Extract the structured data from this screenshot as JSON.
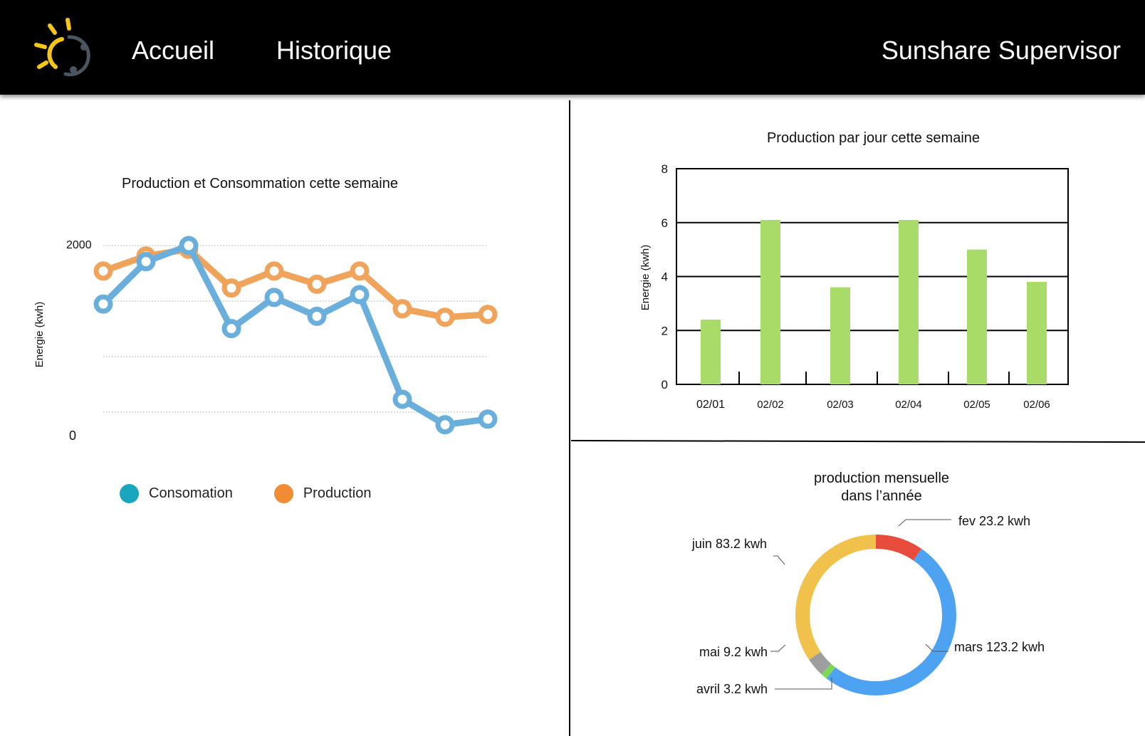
{
  "header": {
    "nav": {
      "home": "Accueil",
      "history": "Historique"
    },
    "brand": "Sunshare Supervisor"
  },
  "colors": {
    "consumption": "#6AAFDC",
    "production": "#F0A35A",
    "bars": "#A8DB67",
    "legend_consumption": "#1AA6BF",
    "legend_production": "#F08C33"
  },
  "left_chart": {
    "title": "Production et Consommation cette semaine",
    "legend": {
      "consumption": "Consomation",
      "production": "Production"
    }
  },
  "right_top_chart": {
    "title": "Production par jour cette semaine"
  },
  "right_bottom_chart": {
    "title_line1": "production mensuelle",
    "title_line2": "dans l’année"
  },
  "chart_data": [
    {
      "type": "line",
      "title": "Production et Consommation cette semaine",
      "ylabel": "Energie (kwh)",
      "y_ticks": [
        "2000",
        "0"
      ],
      "ylim": [
        0,
        2000
      ],
      "grid": true,
      "legend": "bottom",
      "x": [
        1,
        2,
        3,
        4,
        5,
        6,
        7,
        8,
        9,
        10
      ],
      "series": [
        {
          "name": "Consomation",
          "values": [
            1380,
            1830,
            2000,
            1120,
            1450,
            1250,
            1480,
            370,
            100,
            160
          ]
        },
        {
          "name": "Production",
          "values": [
            1730,
            1890,
            1960,
            1550,
            1730,
            1590,
            1730,
            1330,
            1240,
            1270
          ]
        }
      ]
    },
    {
      "type": "bar",
      "title": "Production par jour cette semaine",
      "ylabel": "Energie (kwh)",
      "ylim": [
        0,
        8
      ],
      "y_ticks": [
        "0",
        "2",
        "4",
        "6",
        "8"
      ],
      "grid": true,
      "categories": [
        "02/01",
        "02/02",
        "02/03",
        "02/04",
        "02/05",
        "02/06"
      ],
      "values": [
        2.4,
        6.1,
        3.6,
        6.1,
        5.0,
        3.8
      ]
    },
    {
      "type": "pie",
      "title": "production mensuelle dans l’année",
      "slices": [
        {
          "label": "fev 23.2 kwh",
          "value": 23.2,
          "color": "#E84C3D"
        },
        {
          "label": "mars 123.2 kwh",
          "value": 123.2,
          "color": "#4DA3F2"
        },
        {
          "label": "avril 3.2 kwh",
          "value": 3.2,
          "color": "#7ED957"
        },
        {
          "label": "mai 9.2 kwh",
          "value": 9.2,
          "color": "#9E9E9E"
        },
        {
          "label": "juin 83.2 kwh",
          "value": 83.2,
          "color": "#F0C24B"
        }
      ]
    }
  ]
}
